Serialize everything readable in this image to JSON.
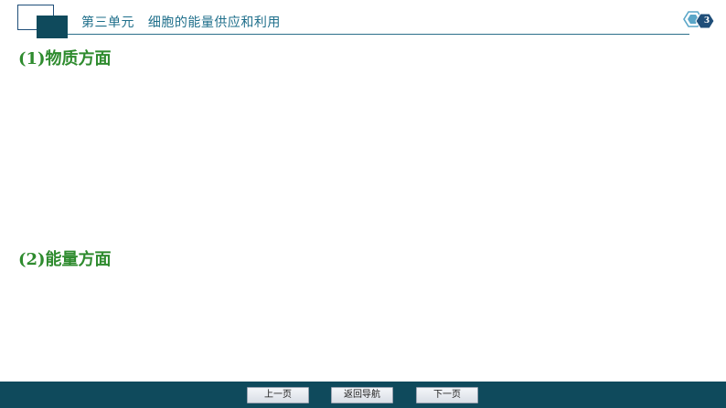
{
  "header": {
    "title": "第三单元   细胞的能量供应和利用",
    "page_number": "3"
  },
  "content": {
    "headings": [
      "(1)物质方面",
      "(2)能量方面"
    ]
  },
  "footer": {
    "prev_label": "上一页",
    "home_label": "返回导航",
    "next_label": "下一页"
  },
  "colors": {
    "accent": "#0f4a5c",
    "heading_green": "#2e8b2e",
    "header_text": "#1f6f8b"
  },
  "icons": {
    "page_badge": "hexagon-badge-icon"
  }
}
